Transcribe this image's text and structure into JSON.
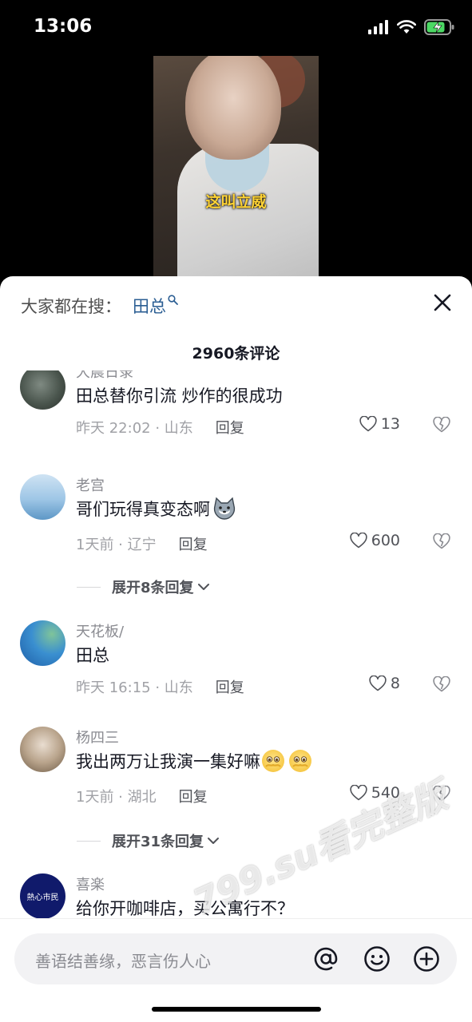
{
  "status": {
    "time": "13:06"
  },
  "video": {
    "subtitle": "这叫立威"
  },
  "search": {
    "label": "大家都在搜：",
    "term": "田总"
  },
  "comment_count": "2960条评论",
  "comments": [
    {
      "user": "大晨日录",
      "text": "田总替你引流 炒作的很成功",
      "meta": "昨天 22:02 · 山东",
      "reply": "回复",
      "likes": "13"
    },
    {
      "user": "老宫",
      "text": "哥们玩得真变态啊",
      "meta": "1天前 · 辽宁",
      "reply": "回复",
      "likes": "600"
    },
    {
      "user": "天花板/",
      "text": "田总",
      "meta": "昨天 16:15 · 山东",
      "reply": "回复",
      "likes": "8"
    },
    {
      "user": "杨四三",
      "text": "我出两万让我演一集好嘛",
      "meta": "1天前 · 湖北",
      "reply": "回复",
      "likes": "540"
    },
    {
      "user": "喜楽",
      "text": "给你开咖啡店，买公寓行不？",
      "avatar_text": "熱心市民"
    }
  ],
  "expand": [
    "展开8条回复",
    "展开31条回复"
  ],
  "input": {
    "placeholder": "善语结善缘，恶言伤人心"
  },
  "watermark": "799.su看完整版",
  "colors": {
    "link": "#2b5e93",
    "subtitle": "#ffd335",
    "battery": "#4cd964"
  }
}
